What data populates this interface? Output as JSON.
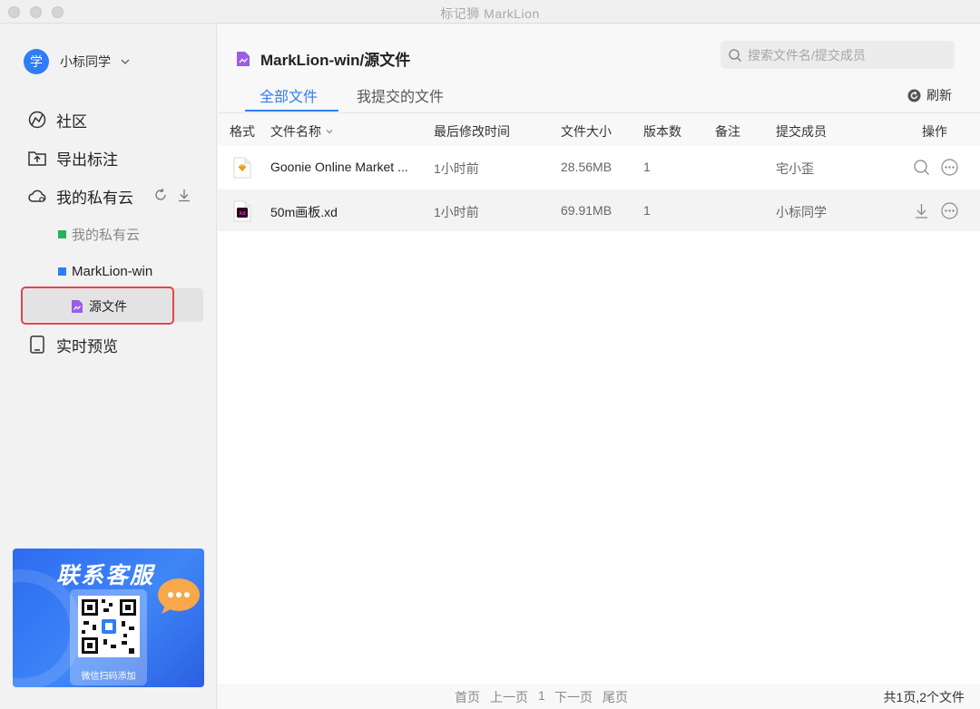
{
  "window": {
    "title": "标记狮 MarkLion"
  },
  "sidebar": {
    "user": {
      "avatar": "学",
      "name": "小标同学"
    },
    "nav": [
      {
        "label": "社区",
        "icon": "community-icon"
      },
      {
        "label": "导出标注",
        "icon": "export-icon"
      },
      {
        "label": "我的私有云",
        "icon": "cloud-icon"
      },
      {
        "label": "实时预览",
        "icon": "tablet-icon"
      }
    ],
    "cloud_children": [
      {
        "label": "我的私有云",
        "color": "#2ab15a"
      },
      {
        "label": "MarkLion-win",
        "color": "#2f7df6"
      }
    ],
    "selected_folder": "源文件",
    "banner": {
      "title": "联系客服",
      "caption": "微信扫码添加"
    }
  },
  "header": {
    "title": "MarkLion-win/源文件",
    "search_placeholder": "搜索文件名/提交成员",
    "tabs": [
      {
        "label": "全部文件",
        "active": true
      },
      {
        "label": "我提交的文件",
        "active": false
      }
    ],
    "refresh_label": "刷新"
  },
  "table": {
    "columns": [
      "格式",
      "文件名称",
      "最后修改时间",
      "文件大小",
      "版本数",
      "备注",
      "提交成员",
      "操作"
    ],
    "rows": [
      {
        "type": "sketch",
        "name": "Goonie Online Market ...",
        "modified": "1小时前",
        "size": "28.56MB",
        "versions": "1",
        "note": "",
        "member": "宅小歪",
        "actions": [
          "search-icon",
          "more-icon"
        ]
      },
      {
        "type": "xd",
        "name": "50m画板.xd",
        "modified": "1小时前",
        "size": "69.91MB",
        "versions": "1",
        "note": "",
        "member": "小标同学",
        "actions": [
          "download-icon",
          "more-icon"
        ]
      }
    ]
  },
  "pagination": {
    "first": "首页",
    "prev": "上一页",
    "current": "1",
    "next": "下一页",
    "last": "尾页",
    "summary": "共1页,2个文件"
  },
  "colors": {
    "accent": "#2f7df6",
    "highlight_border": "#e3444b",
    "file_purple": "#9b5de5"
  }
}
